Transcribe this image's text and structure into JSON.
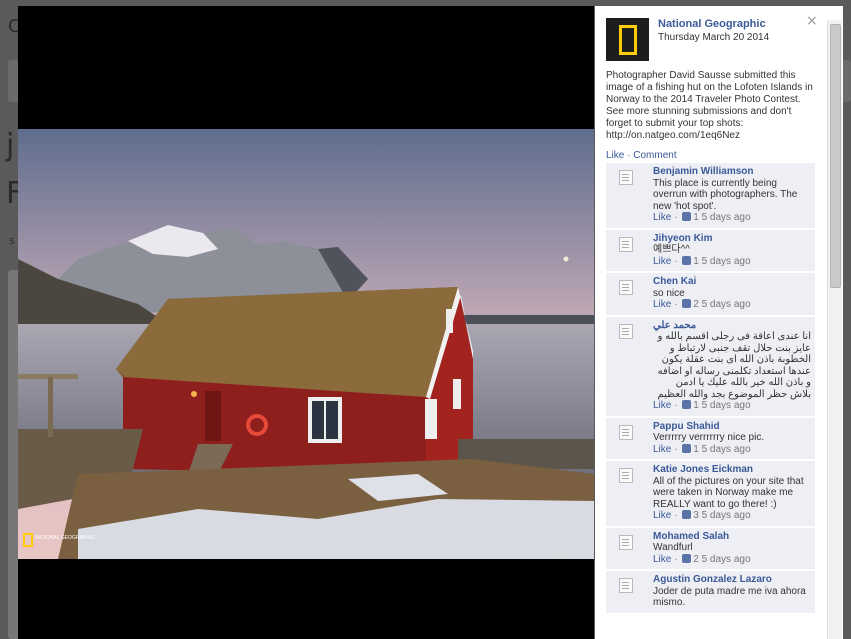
{
  "background_page": {
    "heading_fragments": [
      "j",
      "F",
      "C",
      "s"
    ]
  },
  "post": {
    "page_name": "National Geographic",
    "date": "Thursday March 20 2014",
    "caption": "Photographer David Sausse submitted this image of a fishing hut on the Lofoten Islands in Norway to the 2014 Traveler Photo Contest. See more stunning submissions and don't forget to submit your top shots: http://on.natgeo.com/1eq6Nez",
    "like_label": "Like",
    "separator": "·",
    "comment_label": "Comment",
    "close_symbol": "×"
  },
  "photo": {
    "logo_text": "NATIONAL GEOGRAPHIC",
    "credit_text": "PHOTOGRAPH BY DAVID SAUSSE / NATIONAL GEOGRAPHIC TRAVELER PHOTO CONTEST 2014",
    "copyright_text": "© COPYRIGHT DAVID SAUSSE. ALL RIGHTS RESERVED."
  },
  "comments": [
    {
      "name": "Benjamin Williamson",
      "text": "This place is currently being overrun with photographers. The new 'hot spot'.",
      "likes": "1",
      "time": "5 days ago",
      "rtl": false
    },
    {
      "name": "Jihyeon Kim",
      "text": "예쁘다^^",
      "likes": "1",
      "time": "5 days ago",
      "rtl": false
    },
    {
      "name": "Chen Kai",
      "text": "so nice",
      "likes": "2",
      "time": "5 days ago",
      "rtl": false
    },
    {
      "name": "محمد علي",
      "text": "انا عندى اعاقة فى رجلى اقسم بالله و عايز بنت حلال تقف جنبى لارتباط و الخطوبة باذن الله اى بنت عقلة يكون عندها استعداد تكلمنى رساله او اضافه و باذن الله خير بالله عليك يا ادمن بلاش حظر الموضوع بجد والله العظيم",
      "likes": "1",
      "time": "5 days ago",
      "rtl": true
    },
    {
      "name": "Pappu Shahid",
      "text": "Verrrrry verrrrrry nice pic.",
      "likes": "1",
      "time": "5 days ago",
      "rtl": false
    },
    {
      "name": "Katie Jones Eickman",
      "text": "All of the pictures on your site that were taken in Norway make me REALLY want to go there! :)",
      "likes": "3",
      "time": "5 days ago",
      "rtl": false
    },
    {
      "name": "Mohamed Salah",
      "text": "Wandfurl",
      "likes": "2",
      "time": "5 days ago",
      "rtl": false
    },
    {
      "name": "Agustin Gonzalez Lazaro",
      "text": "Joder de puta madre me iva ahora mismo.",
      "likes": "",
      "time": "",
      "rtl": false
    }
  ],
  "comment_like_label": "Like",
  "colors": {
    "link": "#3b5998",
    "comment_bg": "#edeff4",
    "logo_yellow": "#ffcb05"
  },
  "icons": [
    "close-icon",
    "natgeo-logo-icon",
    "avatar-placeholder-icon",
    "thumbs-up-icon"
  ]
}
